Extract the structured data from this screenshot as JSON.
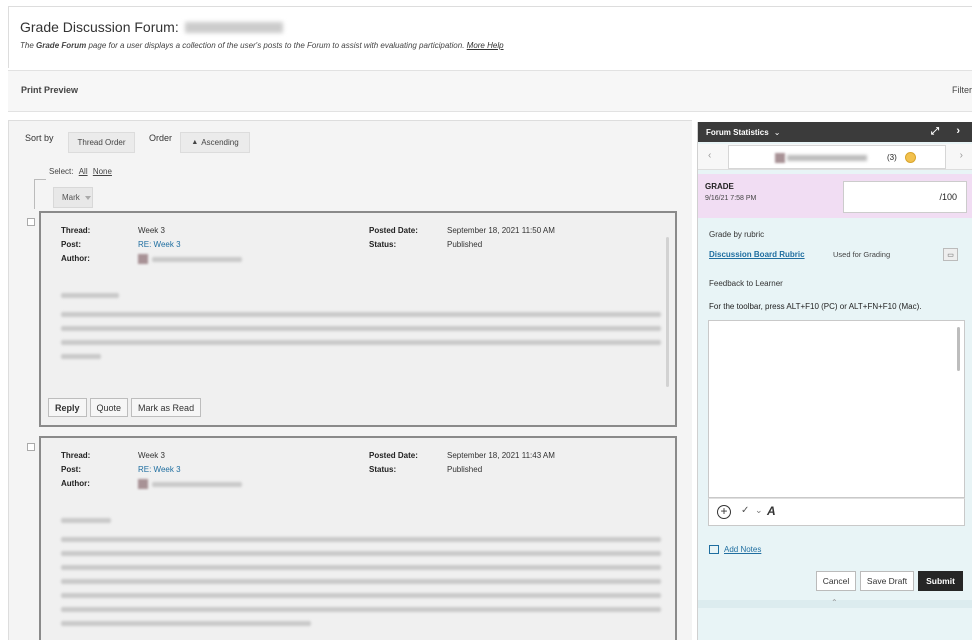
{
  "header": {
    "title": "Grade Discussion Forum:",
    "description_pre": "The ",
    "description_bold": "Grade Forum",
    "description_post": " page for a user displays a collection of the user's posts to the Forum to assist with evaluating participation.",
    "more_help": "More Help"
  },
  "action_bar": {
    "print_preview": "Print Preview",
    "filter": "Filter"
  },
  "toolbar": {
    "sort_by_label": "Sort by",
    "sort_value": "Thread Order",
    "order_label": "Order",
    "order_value": "Ascending",
    "order_arrow": "▲",
    "select_label": "Select:",
    "select_all": "All",
    "select_none": "None",
    "mark_label": "Mark"
  },
  "posts": [
    {
      "thread_label": "Thread:",
      "thread": "Week 3",
      "post_label": "Post:",
      "post": "RE: Week 3",
      "author_label": "Author:",
      "posted_date_label": "Posted Date:",
      "posted_date": "September 18, 2021 11:50 AM",
      "status_label": "Status:",
      "status": "Published",
      "buttons": {
        "reply": "Reply",
        "quote": "Quote",
        "mark_read": "Mark as Read"
      }
    },
    {
      "thread_label": "Thread:",
      "thread": "Week 3",
      "post_label": "Post:",
      "post": "RE: Week 3",
      "author_label": "Author:",
      "posted_date_label": "Posted Date:",
      "posted_date": "September 18, 2021 11:43 AM",
      "status_label": "Status:",
      "status": "Published"
    }
  ],
  "panel": {
    "header": "Forum Statistics",
    "header_caret": "⌄",
    "expand_glyph": "⤢",
    "next_glyph": "›",
    "prev_glyph": "‹",
    "user_count": "(3)",
    "grade_label": "GRADE",
    "grade_date": "9/16/21 7:58 PM",
    "grade_out_of": "/100",
    "grade_by_rubric": "Grade by rubric",
    "rubric_link": "Discussion Board Rubric",
    "rubric_note": "Used for Grading",
    "feedback_label": "Feedback to Learner",
    "toolbar_hint": "For the toolbar, press ALT+F10 (PC) or ALT+FN+F10 (Mac).",
    "add_glyph": "+",
    "spell_glyph": "✓",
    "caret_glyph": "⌄",
    "format_glyph": "A",
    "add_notes": "Add Notes",
    "cancel": "Cancel",
    "save_draft": "Save Draft",
    "submit": "Submit",
    "collapse_glyph": "⌃"
  }
}
